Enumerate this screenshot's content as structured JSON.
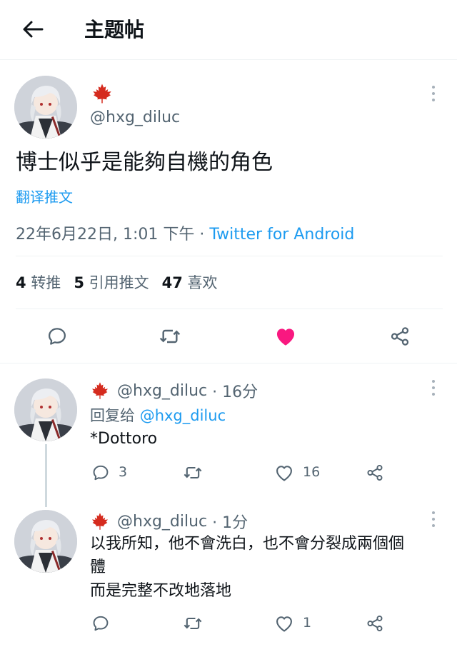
{
  "header": {
    "title": "主题帖"
  },
  "main_tweet": {
    "handle": "@hxg_diluc",
    "text": "博士似乎是能夠自機的角色",
    "translate_label": "翻译推文",
    "timestamp": "22年6月22日, 1:01 下午",
    "separator": " · ",
    "source": "Twitter for Android",
    "stats": {
      "retweets_count": "4",
      "retweets_label": "转推",
      "quotes_count": "5",
      "quotes_label": "引用推文",
      "likes_count": "47",
      "likes_label": "喜欢"
    },
    "liked": true
  },
  "replies": [
    {
      "handle": "@hxg_diluc",
      "time": "· 16分",
      "reply_to_label": "回复给",
      "reply_to_handle": "@hxg_diluc",
      "text": "*Dottoro",
      "reply_count": "3",
      "retweet_count": "",
      "like_count": "16"
    },
    {
      "handle": "@hxg_diluc",
      "time": "· 1分",
      "text_line1": "以我所知，他不會洗白，也不會分裂成兩個個",
      "text_line2": "體",
      "text_line3": "而是完整不改地落地",
      "reply_count": "",
      "retweet_count": "",
      "like_count": "1"
    }
  ],
  "colors": {
    "accent": "#1d9bf0",
    "like": "#f91880",
    "flag": "#d52b1e",
    "muted": "#536471"
  },
  "icons": [
    "back-arrow-icon",
    "maple-leaf-icon",
    "more-icon",
    "reply-icon",
    "retweet-icon",
    "heart-icon",
    "share-icon"
  ]
}
